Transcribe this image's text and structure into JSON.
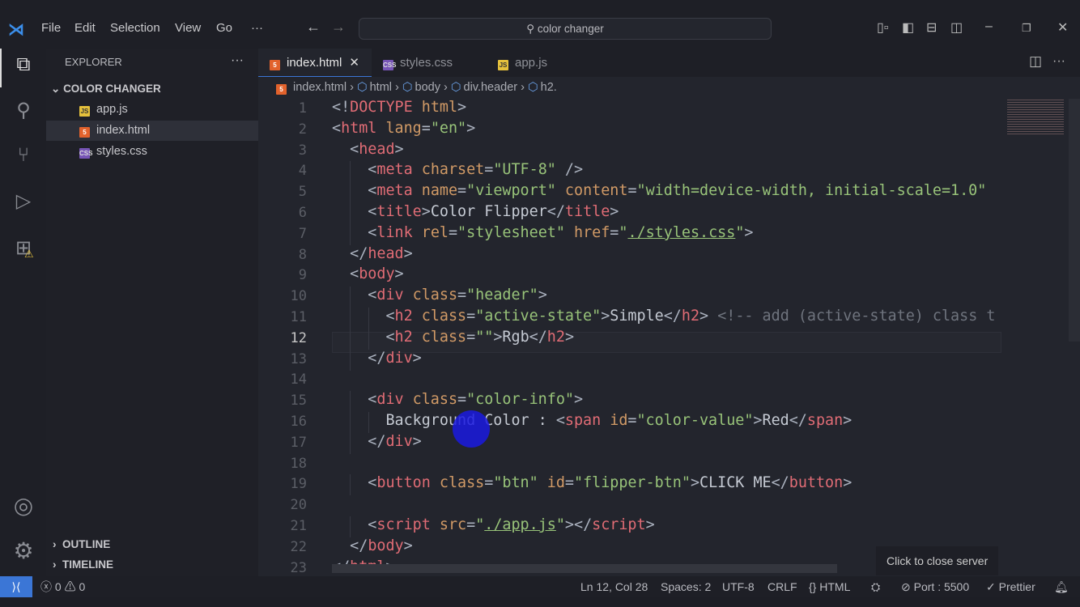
{
  "titlebar": {
    "menu": [
      "File",
      "Edit",
      "Selection",
      "View",
      "Go",
      "···"
    ],
    "search": "color changer"
  },
  "sidebar": {
    "title": "EXPLORER",
    "more": "···",
    "folder": "COLOR CHANGER",
    "files": [
      {
        "name": "app.js",
        "type": "js",
        "badge": "JS"
      },
      {
        "name": "index.html",
        "type": "htm",
        "badge": "5"
      },
      {
        "name": "styles.css",
        "type": "css",
        "badge": "CSS"
      }
    ],
    "selected": 1,
    "outline": "OUTLINE",
    "timeline": "TIMELINE"
  },
  "tabs": [
    {
      "name": "index.html",
      "type": "htm",
      "badge": "5",
      "active": true,
      "close": "✕"
    },
    {
      "name": "styles.css",
      "type": "css",
      "badge": "CSS"
    },
    {
      "name": "app.js",
      "type": "js",
      "badge": "JS"
    }
  ],
  "breadcrumb": [
    "index.html",
    "html",
    "body",
    "div.header",
    "h2."
  ],
  "editor": {
    "current_line": 12,
    "lines": [
      [
        0,
        [
          [
            "p",
            "<!"
          ],
          [
            "t",
            "DOCTYPE"
          ],
          [
            "a",
            " html"
          ],
          [
            "p",
            ">"
          ]
        ]
      ],
      [
        0,
        [
          [
            "p",
            "<"
          ],
          [
            "t",
            "html"
          ],
          [
            "a",
            " lang"
          ],
          [
            "p",
            "="
          ],
          [
            "s",
            "\"en\""
          ],
          [
            "p",
            ">"
          ]
        ]
      ],
      [
        1,
        [
          [
            "p",
            "<"
          ],
          [
            "t",
            "head"
          ],
          [
            "p",
            ">"
          ]
        ]
      ],
      [
        2,
        [
          [
            "p",
            "<"
          ],
          [
            "t",
            "meta"
          ],
          [
            "a",
            " charset"
          ],
          [
            "p",
            "="
          ],
          [
            "s",
            "\"UTF-8\""
          ],
          [
            "p",
            " />"
          ]
        ]
      ],
      [
        2,
        [
          [
            "p",
            "<"
          ],
          [
            "t",
            "meta"
          ],
          [
            "a",
            " name"
          ],
          [
            "p",
            "="
          ],
          [
            "s",
            "\"viewport\""
          ],
          [
            "a",
            " content"
          ],
          [
            "p",
            "="
          ],
          [
            "s",
            "\"width=device-width, initial-scale=1.0\""
          ]
        ]
      ],
      [
        2,
        [
          [
            "p",
            "<"
          ],
          [
            "t",
            "title"
          ],
          [
            "p",
            ">"
          ],
          [
            "x",
            "Color Flipper"
          ],
          [
            "p",
            "</"
          ],
          [
            "t",
            "title"
          ],
          [
            "p",
            ">"
          ]
        ]
      ],
      [
        2,
        [
          [
            "p",
            "<"
          ],
          [
            "t",
            "link"
          ],
          [
            "a",
            " rel"
          ],
          [
            "p",
            "="
          ],
          [
            "s",
            "\"stylesheet\""
          ],
          [
            "a",
            " href"
          ],
          [
            "p",
            "="
          ],
          [
            "s",
            "\""
          ],
          [
            "u",
            "./styles.css"
          ],
          [
            "s",
            "\""
          ],
          [
            "p",
            ">"
          ]
        ]
      ],
      [
        1,
        [
          [
            "p",
            "</"
          ],
          [
            "t",
            "head"
          ],
          [
            "p",
            ">"
          ]
        ]
      ],
      [
        1,
        [
          [
            "p",
            "<"
          ],
          [
            "t",
            "body"
          ],
          [
            "p",
            ">"
          ]
        ]
      ],
      [
        2,
        [
          [
            "p",
            "<"
          ],
          [
            "t",
            "div"
          ],
          [
            "a",
            " class"
          ],
          [
            "p",
            "="
          ],
          [
            "s",
            "\"header\""
          ],
          [
            "p",
            ">"
          ]
        ]
      ],
      [
        3,
        [
          [
            "p",
            "<"
          ],
          [
            "t",
            "h2"
          ],
          [
            "a",
            " class"
          ],
          [
            "p",
            "="
          ],
          [
            "s",
            "\"active-state\""
          ],
          [
            "p",
            ">"
          ],
          [
            "x",
            "Simple"
          ],
          [
            "p",
            "</"
          ],
          [
            "t",
            "h2"
          ],
          [
            "p",
            "> "
          ],
          [
            "c",
            "<!-- add (active-state) class t"
          ]
        ]
      ],
      [
        3,
        [
          [
            "p",
            "<"
          ],
          [
            "t",
            "h2"
          ],
          [
            "a",
            " class"
          ],
          [
            "p",
            "="
          ],
          [
            "s",
            "\"\""
          ],
          [
            "p",
            ">"
          ],
          [
            "x",
            "Rgb"
          ],
          [
            "p",
            "</"
          ],
          [
            "t",
            "h2"
          ],
          [
            "p",
            ">"
          ]
        ]
      ],
      [
        2,
        [
          [
            "p",
            "</"
          ],
          [
            "t",
            "div"
          ],
          [
            "p",
            ">"
          ]
        ]
      ],
      [
        0,
        []
      ],
      [
        2,
        [
          [
            "p",
            "<"
          ],
          [
            "t",
            "div"
          ],
          [
            "a",
            " class"
          ],
          [
            "p",
            "="
          ],
          [
            "s",
            "\"color-info\""
          ],
          [
            "p",
            ">"
          ]
        ]
      ],
      [
        3,
        [
          [
            "x",
            "Background Color : "
          ],
          [
            "p",
            "<"
          ],
          [
            "t",
            "span"
          ],
          [
            "a",
            " id"
          ],
          [
            "p",
            "="
          ],
          [
            "s",
            "\"color-value\""
          ],
          [
            "p",
            ">"
          ],
          [
            "x",
            "Red"
          ],
          [
            "p",
            "</"
          ],
          [
            "t",
            "span"
          ],
          [
            "p",
            ">"
          ]
        ]
      ],
      [
        2,
        [
          [
            "p",
            "</"
          ],
          [
            "t",
            "div"
          ],
          [
            "p",
            ">"
          ]
        ]
      ],
      [
        0,
        []
      ],
      [
        2,
        [
          [
            "p",
            "<"
          ],
          [
            "t",
            "button"
          ],
          [
            "a",
            " class"
          ],
          [
            "p",
            "="
          ],
          [
            "s",
            "\"btn\""
          ],
          [
            "a",
            " id"
          ],
          [
            "p",
            "="
          ],
          [
            "s",
            "\"flipper-btn\""
          ],
          [
            "p",
            ">"
          ],
          [
            "x",
            "CLICK ME"
          ],
          [
            "p",
            "</"
          ],
          [
            "t",
            "button"
          ],
          [
            "p",
            ">"
          ]
        ]
      ],
      [
        0,
        []
      ],
      [
        2,
        [
          [
            "p",
            "<"
          ],
          [
            "t",
            "script"
          ],
          [
            "a",
            " src"
          ],
          [
            "p",
            "="
          ],
          [
            "s",
            "\""
          ],
          [
            "u",
            "./app.js"
          ],
          [
            "s",
            "\""
          ],
          [
            "p",
            "></"
          ],
          [
            "t",
            "script"
          ],
          [
            "p",
            ">"
          ]
        ]
      ],
      [
        1,
        [
          [
            "p",
            "</"
          ],
          [
            "t",
            "body"
          ],
          [
            "p",
            ">"
          ]
        ]
      ],
      [
        0,
        [
          [
            "p",
            "</"
          ],
          [
            "t",
            "html"
          ],
          [
            "p",
            ">"
          ]
        ]
      ]
    ]
  },
  "tooltip": "Click to close server",
  "status": {
    "errors": "0",
    "warnings": "0",
    "position": "Ln 12, Col 28",
    "spaces": "Spaces: 2",
    "encoding": "UTF-8",
    "eol": "CRLF",
    "language": "HTML",
    "port": "Port : 5500",
    "prettier": "Prettier"
  }
}
